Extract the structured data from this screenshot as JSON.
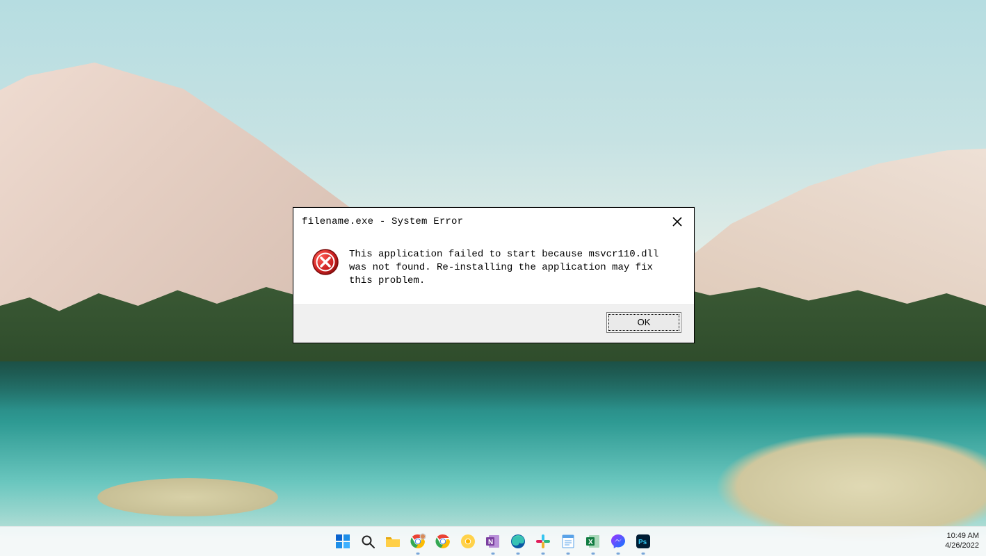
{
  "dialog": {
    "title": "filename.exe - System Error",
    "message": "This application failed to start because msvcr110.dll was not found. Re-installing the application may fix this problem.",
    "ok_label": "OK"
  },
  "taskbar": {
    "icons": [
      {
        "name": "start",
        "title": "Start"
      },
      {
        "name": "search",
        "title": "Search"
      },
      {
        "name": "explorer",
        "title": "File Explorer"
      },
      {
        "name": "chrome",
        "title": "Google Chrome",
        "running": true
      },
      {
        "name": "chrome-alt",
        "title": "Google Chrome"
      },
      {
        "name": "chrome-canary",
        "title": "Chrome Canary"
      },
      {
        "name": "onenote",
        "title": "OneNote",
        "running": true
      },
      {
        "name": "edge",
        "title": "Microsoft Edge",
        "running": true
      },
      {
        "name": "slack",
        "title": "Slack",
        "running": true
      },
      {
        "name": "notepad",
        "title": "Notepad",
        "running": true
      },
      {
        "name": "excel",
        "title": "Excel",
        "running": true
      },
      {
        "name": "messenger",
        "title": "Messenger",
        "running": true
      },
      {
        "name": "photoshop",
        "title": "Photoshop",
        "running": true
      }
    ]
  },
  "tray": {
    "time": "10:49 AM",
    "date": "4/26/2022"
  }
}
